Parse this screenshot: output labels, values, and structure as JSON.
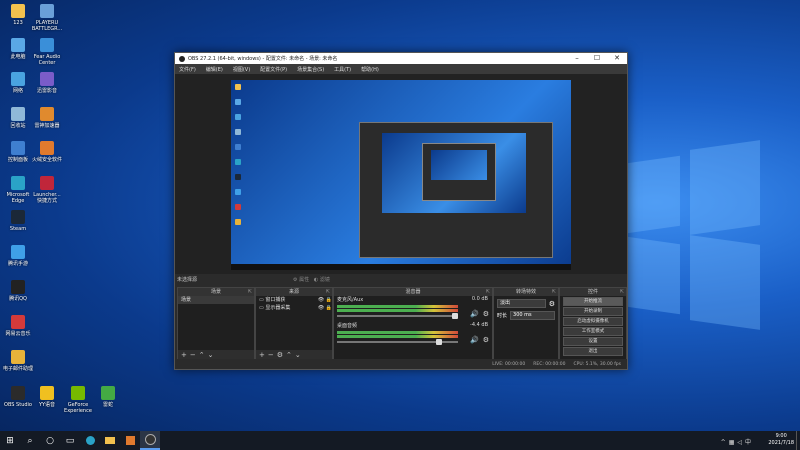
{
  "desktop": {
    "icons": [
      {
        "label": "123",
        "color": "#f2c14e"
      },
      {
        "label": "PLAYERU\nBATTLEGR...",
        "color": "#6aa0d8"
      },
      {
        "label": "此电脑",
        "color": "#5aa8e6"
      },
      {
        "label": "Fear Audio\nCenter",
        "color": "#3a8fd9"
      },
      {
        "label": "网络",
        "color": "#4aa3e0"
      },
      {
        "label": "迅雷影音",
        "color": "#7a5cc9"
      },
      {
        "label": "回收站",
        "color": "#8fb8d8"
      },
      {
        "label": "雷神加速器",
        "color": "#e08a2e"
      },
      {
        "label": "控制面板",
        "color": "#3f7fd0"
      },
      {
        "label": "火绒安全软件",
        "color": "#e07a2e"
      },
      {
        "label": "Microsoft\nEdge",
        "color": "#2aa3c7"
      },
      {
        "label": "Launcher...\n快捷方式",
        "color": "#c0263a"
      },
      {
        "label": "Steam",
        "color": "#1b2838"
      },
      {
        "label": "腾讯手游",
        "color": "#3fa0e8"
      },
      {
        "label": "腾讯QQ",
        "color": "#222222"
      },
      {
        "label": "网易云音乐",
        "color": "#d33a3a"
      },
      {
        "label": "电子邮件助理",
        "color": "#e8b33a"
      },
      {
        "label": "OBS Studio",
        "color": "#2b2b2b"
      },
      {
        "label": "YY语音",
        "color": "#f0c020"
      },
      {
        "label": "GeForce\nExperience",
        "color": "#76b900"
      },
      {
        "label": "雷蛇",
        "color": "#44aa44"
      }
    ]
  },
  "obs": {
    "title": "OBS 27.2.1 (64-bit, windows) - 配置文件: 未命名 - 场景: 未命名",
    "menu": [
      "文件(F)",
      "编辑(E)",
      "视图(V)",
      "配置文件(P)",
      "场景集合(S)",
      "工具(T)",
      "帮助(H)"
    ],
    "scene_label": "未选择源",
    "transition_buttons": [
      "属性",
      "滤镜"
    ],
    "docks": {
      "scenes": {
        "title": "场景",
        "items": [
          "场景"
        ]
      },
      "sources": {
        "title": "来源",
        "items": [
          "窗口捕获",
          "显示器采集"
        ]
      },
      "mixer": {
        "title": "混音器",
        "tracks": [
          {
            "name": "麦克风/Aux",
            "db": "0.0 dB"
          },
          {
            "name": "桌面音频",
            "db": "-4.4 dB"
          }
        ]
      },
      "transitions": {
        "title": "转场特效",
        "type": "淡出",
        "duration_label": "时长",
        "duration": "300 ms"
      },
      "controls": {
        "title": "控件",
        "buttons": [
          "开始推流",
          "开始录制",
          "启动虚拟摄像机",
          "工作室模式",
          "设置",
          "退出"
        ]
      }
    },
    "status": {
      "live": "LIVE: 00:00:00",
      "rec": "REC: 00:00:00",
      "cpu": "CPU: 5.1%, 30.00 fps"
    }
  },
  "taskbar": {
    "time": "9:00",
    "date": "2021/7/18"
  }
}
